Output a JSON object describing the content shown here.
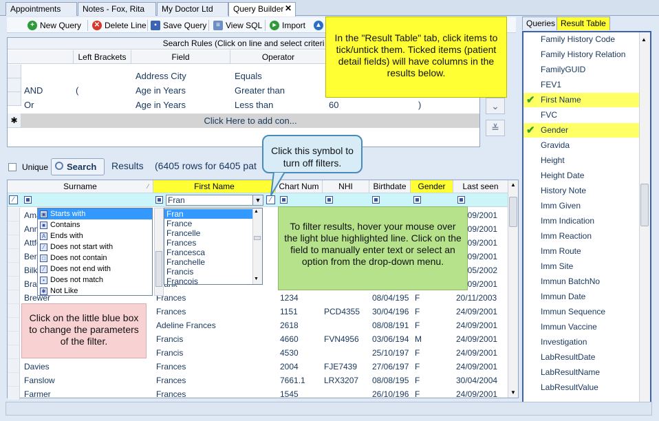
{
  "tabs": [
    {
      "label": "Appointments"
    },
    {
      "label": "Notes - Fox, Rita"
    },
    {
      "label": "My Doctor Ltd"
    },
    {
      "label": "Query Builder",
      "close": "✕"
    }
  ],
  "toolbar": {
    "new_query": "New Query",
    "delete_line": "Delete Line",
    "save_query": "Save Query",
    "view_sql": "View SQL",
    "import": "Import"
  },
  "rules": {
    "title": "Search Rules (Click on line and select criteri",
    "headers": [
      "Left Brackets",
      "Field",
      "Operator"
    ],
    "rows": [
      {
        "connector": "",
        "bracket": "",
        "field": "Address City",
        "operator": "Equals",
        "value": "",
        "close": ""
      },
      {
        "connector": "AND",
        "bracket": "(",
        "field": "Age in Years",
        "operator": "Greater than",
        "value": "",
        "close": ""
      },
      {
        "connector": "Or",
        "bracket": "",
        "field": "Age in Years",
        "operator": "Less than",
        "value": "60",
        "close": ")"
      }
    ],
    "new_row_marker": "✱",
    "add_line": "Click Here to add con..."
  },
  "search": {
    "unique_label": "Unique",
    "search_button": "Search",
    "results_label": "Results",
    "results_count": "(6405 rows for 6405 pat"
  },
  "grid": {
    "headers": [
      "Surname",
      "First Name",
      "Chart Num",
      "NHI",
      "Birthdate",
      "Gender",
      "Last seen"
    ],
    "filter_value": "Fran",
    "rows": [
      [
        "Ama",
        "",
        "",
        "",
        "",
        "",
        "24/09/2001"
      ],
      [
        "Ann",
        "",
        "",
        "",
        "",
        "",
        "24/09/2001"
      ],
      [
        "Attfe",
        "",
        "",
        "",
        "",
        "",
        "24/09/2001"
      ],
      [
        "Bers",
        "",
        "",
        "",
        "",
        "",
        "24/09/2001"
      ],
      [
        "Bilk",
        "",
        "",
        "",
        "",
        "",
        "05/05/2002"
      ],
      [
        "Bra",
        "Frank",
        "2772.1",
        "",
        "07/03/200",
        "M",
        "24/09/2001"
      ],
      [
        "Brewer",
        "Frances",
        "1234",
        "",
        "08/04/195",
        "F",
        "20/11/2003"
      ],
      [
        "",
        "Frances",
        "1151",
        "PCD4355",
        "30/04/196",
        "F",
        "24/09/2001"
      ],
      [
        "",
        "Adeline Frances",
        "2618",
        "",
        "08/08/191",
        "F",
        "24/09/2001"
      ],
      [
        "",
        "Francis",
        "4660",
        "FVN4956",
        "03/06/194",
        "M",
        "24/09/2001"
      ],
      [
        "",
        "Francis",
        "4530",
        "",
        "25/10/197",
        "F",
        "24/09/2001"
      ],
      [
        "Davies",
        "Frances",
        "2004",
        "FJE7439",
        "27/06/197",
        "F",
        "24/09/2001"
      ],
      [
        "Fanslow",
        "Frances",
        "7661.1",
        "LRX3207",
        "08/08/195",
        "F",
        "30/04/2004"
      ],
      [
        "Farmer",
        "Frances",
        "1545",
        "",
        "26/10/196",
        "F",
        "24/09/2001"
      ]
    ]
  },
  "filter_ops": [
    {
      "label": "Starts with",
      "icon": "▣"
    },
    {
      "label": "Contains",
      "icon": "■"
    },
    {
      "label": "Ends with",
      "icon": "A"
    },
    {
      "label": "Does not start with",
      "icon": "⁄"
    },
    {
      "label": "Does not contain",
      "icon": "□"
    },
    {
      "label": "Does not end with",
      "icon": "⁄"
    },
    {
      "label": "Does not match",
      "icon": "•"
    },
    {
      "label": "Not Like",
      "icon": "✱"
    }
  ],
  "filter_dropdown": [
    "Fran",
    "France",
    "Francelle",
    "Frances",
    "Francesca",
    "Franchelle",
    "Francis",
    "Francois"
  ],
  "right_panel": {
    "tabs": [
      "Queries",
      "Result Table"
    ],
    "items": [
      {
        "label": "Family History Code",
        "checked": false
      },
      {
        "label": "Family History Relation",
        "checked": false
      },
      {
        "label": "FamilyGUID",
        "checked": false
      },
      {
        "label": "FEV1",
        "checked": false
      },
      {
        "label": "First Name",
        "checked": true
      },
      {
        "label": "FVC",
        "checked": false
      },
      {
        "label": "Gender",
        "checked": true
      },
      {
        "label": "Gravida",
        "checked": false
      },
      {
        "label": "Height",
        "checked": false
      },
      {
        "label": "Height Date",
        "checked": false
      },
      {
        "label": "History Note",
        "checked": false
      },
      {
        "label": "Imm Given",
        "checked": false
      },
      {
        "label": "Imm Indication",
        "checked": false
      },
      {
        "label": "Imm Reaction",
        "checked": false
      },
      {
        "label": "Imm Route",
        "checked": false
      },
      {
        "label": "Imm Site",
        "checked": false
      },
      {
        "label": "Immun BatchNo",
        "checked": false
      },
      {
        "label": "Immun Date",
        "checked": false
      },
      {
        "label": "Immun Sequence",
        "checked": false
      },
      {
        "label": "Immun Vaccine",
        "checked": false
      },
      {
        "label": "Investigation",
        "checked": false
      },
      {
        "label": "LabResultDate",
        "checked": false
      },
      {
        "label": "LabResultName",
        "checked": false
      },
      {
        "label": "LabResultValue",
        "checked": false
      }
    ],
    "check_mark": "✔"
  },
  "notes": {
    "result_table": "In the \"Result Table\" tab, click items to tick/untick them. Ticked items (patient detail fields) will have columns in the results below.",
    "filter_symbol": "Click this symbol to turn off filters.",
    "filter_results": "To filter results, hover your mouse over the light blue highlighted line. Click on the field to manually enter text or select an option from the drop-down menu.",
    "blue_box": "Click on the little blue box to change the parameters of the filter."
  },
  "colors": {
    "highlight_yellow": "#ffff33",
    "filter_row": "#ccf5f9",
    "accent_blue": "#3a62b0"
  }
}
